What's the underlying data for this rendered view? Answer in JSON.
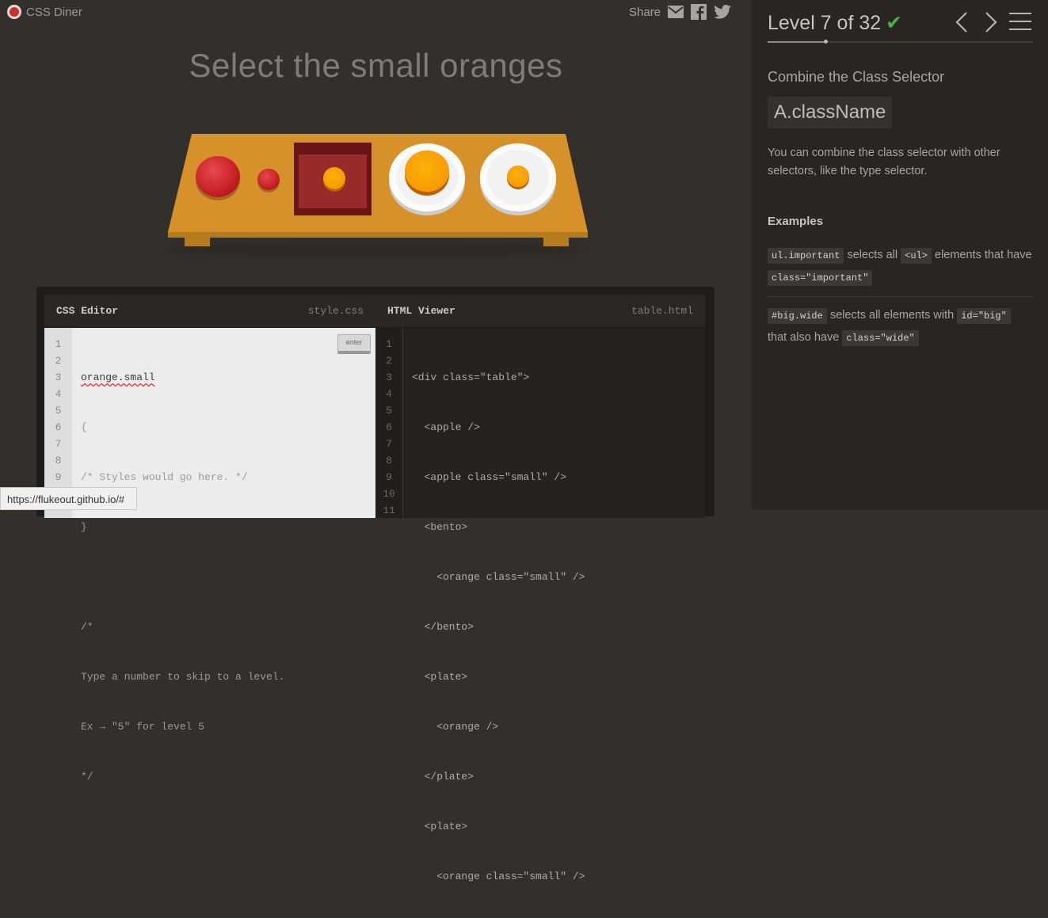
{
  "header": {
    "app_name": "CSS Diner",
    "share_label": "Share",
    "share_icons": [
      "mail-icon",
      "facebook-icon",
      "twitter-icon"
    ]
  },
  "level": {
    "instruction": "Select the small oranges",
    "title": "Level 7 of 32",
    "current": 7,
    "total": 32,
    "completed": true
  },
  "table_items": [
    "apple",
    "apple.small",
    "bento > orange.small",
    "plate > orange",
    "plate > orange.small"
  ],
  "css_editor": {
    "title": "CSS Editor",
    "filename": "style.css",
    "enter_label": "enter",
    "line_numbers": [
      "1",
      "2",
      "3",
      "4",
      "5",
      "6",
      "7",
      "8",
      "9"
    ],
    "input_value": "orange.small",
    "lines": [
      "{",
      "/* Styles would go here. */",
      "}",
      "",
      "/*",
      "Type a number to skip to a level.",
      "Ex → \"5\" for level 5",
      "*/"
    ]
  },
  "html_viewer": {
    "title": "HTML Viewer",
    "filename": "table.html",
    "line_numbers": [
      "1",
      "2",
      "3",
      "4",
      "5",
      "6",
      "7",
      "8",
      "9",
      "10",
      "11"
    ],
    "lines": [
      "<div class=\"table\">",
      "  <apple />",
      "  <apple class=\"small\" />",
      "  <bento>",
      "    <orange class=\"small\" />",
      "  </bento>",
      "  <plate>",
      "    <orange />",
      "  </plate>",
      "  <plate>",
      "    <orange class=\"small\" />"
    ]
  },
  "status_bar": {
    "url": "https://flukeout.github.io/#"
  },
  "sidebar": {
    "subtitle": "Combine the Class Selector",
    "syntax": "A.className",
    "description": "You can combine the class selector with other selectors, like the type selector.",
    "examples_title": "Examples",
    "example1": {
      "code1": "ul.important",
      "text1": "selects all",
      "code2": "<ul>",
      "text2": "elements that have",
      "code3": "class=\"important\""
    },
    "example2": {
      "code1": "#big.wide",
      "text1": "selects all elements with",
      "code2": "id=\"big\"",
      "text2": "that also have",
      "code3": "class=\"wide\""
    }
  },
  "colors": {
    "accent_check": "#4cae4c",
    "table": "#d6912a",
    "apple": "#c01820",
    "orange": "#f29100"
  }
}
